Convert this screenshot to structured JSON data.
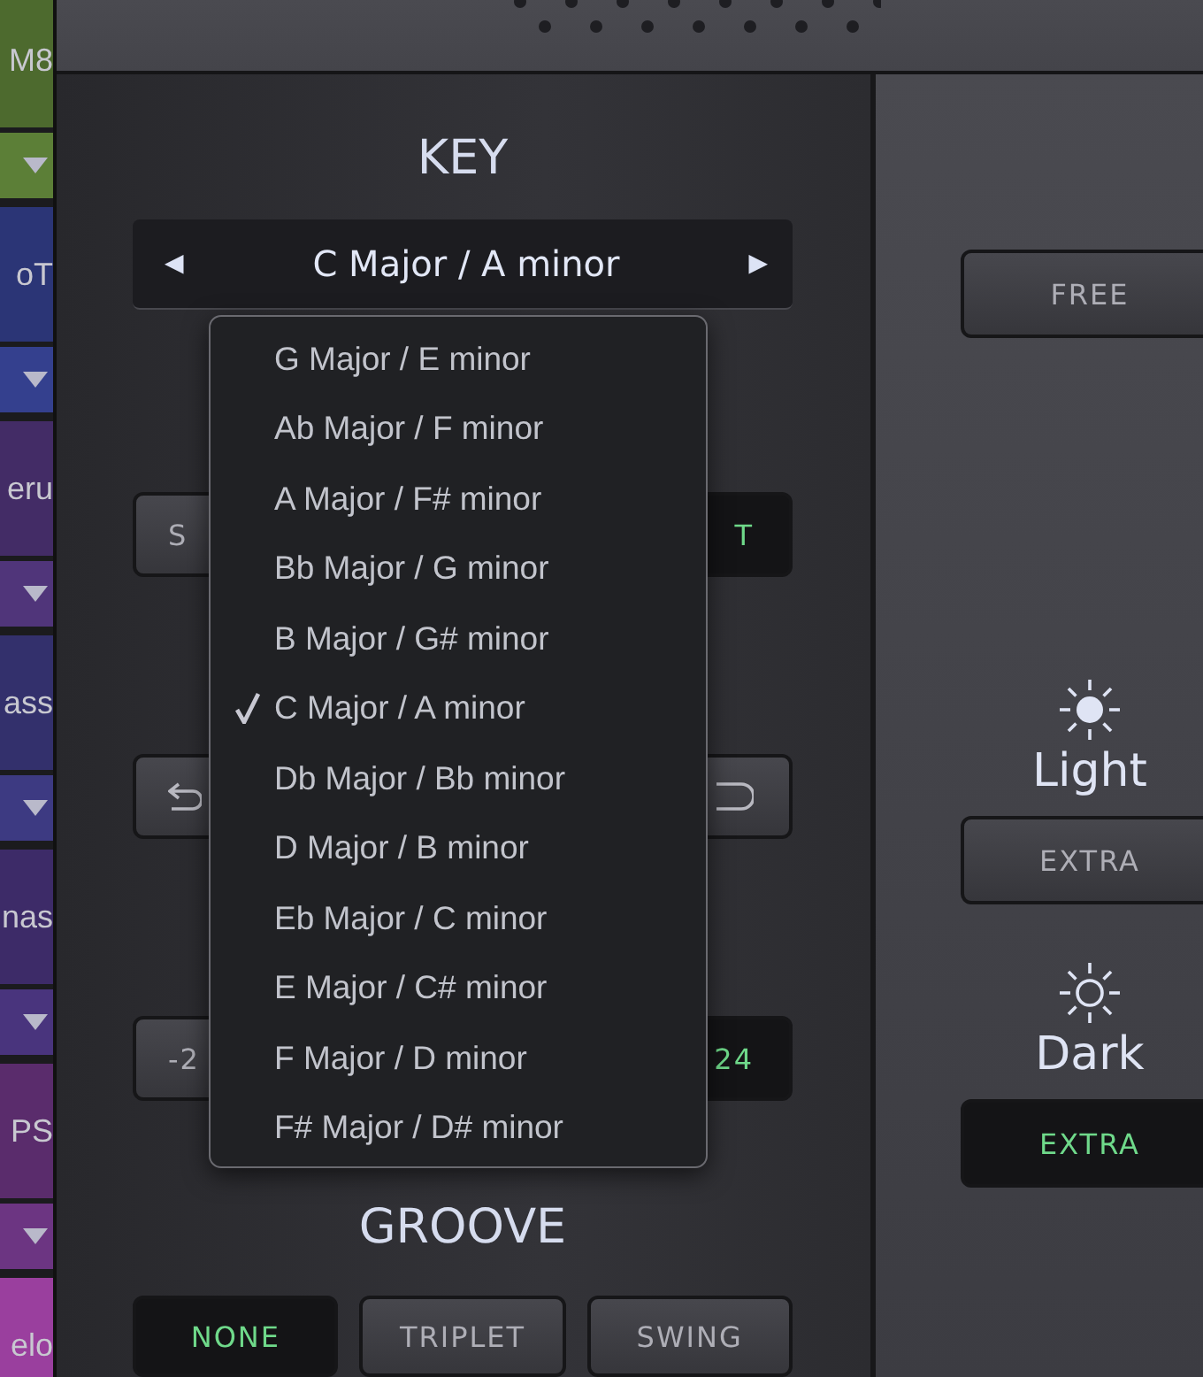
{
  "tracks": [
    {
      "name": "M8",
      "color": "#4d6a2e"
    },
    {
      "name": "oT",
      "color": "#2b3576"
    },
    {
      "name": "eru",
      "color": "#432c66"
    },
    {
      "name": "ass",
      "color": "#33306c"
    },
    {
      "name": "nas",
      "color": "#3d2b68"
    },
    {
      "name": "PS",
      "color": "#5a2c6c"
    },
    {
      "name": "elo",
      "color": "#9a3f9e"
    }
  ],
  "key": {
    "title": "KEY",
    "prev": "◀",
    "value": "C Major / A minor",
    "next": "▶"
  },
  "key_menu": {
    "items": [
      {
        "label": "G Major / E minor",
        "selected": false
      },
      {
        "label": "Ab Major / F minor",
        "selected": false
      },
      {
        "label": "A Major / F# minor",
        "selected": false
      },
      {
        "label": "Bb Major / G minor",
        "selected": false
      },
      {
        "label": "B Major / G# minor",
        "selected": false
      },
      {
        "label": "C Major / A minor",
        "selected": true
      },
      {
        "label": "Db Major / Bb minor",
        "selected": false
      },
      {
        "label": "D Major / B minor",
        "selected": false
      },
      {
        "label": "Eb Major / C minor",
        "selected": false
      },
      {
        "label": "E Major / C# minor",
        "selected": false
      },
      {
        "label": "F Major / D minor",
        "selected": false
      },
      {
        "label": "F# Major / D# minor",
        "selected": false
      }
    ]
  },
  "rows": [
    {
      "left": {
        "kind": "text",
        "label": "S",
        "active": false
      },
      "right": {
        "kind": "text",
        "label": "T",
        "active": true
      }
    },
    {
      "left": {
        "kind": "undo",
        "active": false
      },
      "right": {
        "kind": "curve",
        "active": false
      }
    },
    {
      "left": {
        "kind": "text",
        "label": "-2",
        "active": false
      },
      "right": {
        "kind": "text",
        "label": "24",
        "active": true
      }
    }
  ],
  "groove": {
    "title": "GROOVE",
    "options": [
      {
        "label": "NONE",
        "selected": true
      },
      {
        "label": "TRIPLET",
        "selected": false
      },
      {
        "label": "SWING",
        "selected": false
      }
    ]
  },
  "side": {
    "mode_button": {
      "label": "FREE",
      "active": false
    },
    "themes": [
      {
        "kind": "light",
        "label": "Light",
        "button": {
          "label": "EXTRA",
          "active": false
        }
      },
      {
        "kind": "dark",
        "label": "Dark",
        "button": {
          "label": "EXTRA",
          "active": true
        }
      }
    ]
  }
}
